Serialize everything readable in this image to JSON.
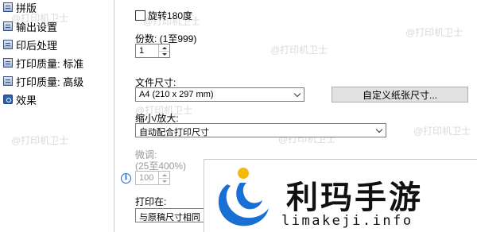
{
  "sidebar": {
    "items": [
      {
        "label": "拼版",
        "icon": "layout-icon"
      },
      {
        "label": "输出设置",
        "icon": "output-settings-icon"
      },
      {
        "label": "印后处理",
        "icon": "finishing-icon"
      },
      {
        "label": "打印质量: 标准",
        "icon": "quality-standard-icon"
      },
      {
        "label": "打印质量: 高级",
        "icon": "quality-advanced-icon"
      },
      {
        "label": "效果",
        "icon": "effects-icon"
      }
    ]
  },
  "main": {
    "rotate_label": "旋转180度",
    "rotate_checked": false,
    "copies_label": "份数: (1至999)",
    "copies_value": "1",
    "paper_size_label": "文件尺寸:",
    "paper_size_value": "A4 (210 x 297 mm)",
    "custom_size_button": "自定义纸张尺寸...",
    "scale_label": "缩小/放大:",
    "scale_value": "自动配合打印尺寸",
    "fine_tune_label": "微调:",
    "fine_tune_range": "(25至400%)",
    "fine_tune_value": "100",
    "print_on_label": "打印在:",
    "print_on_value": "与原稿尺寸相同"
  },
  "watermarks": {
    "text": "@打印机卫士"
  },
  "logo": {
    "title": "利玛手游",
    "subtitle": "limakeji.info",
    "colors": {
      "blue": "#1a6fd4",
      "yellow": "#f2b90f",
      "dark": "#111111"
    }
  }
}
